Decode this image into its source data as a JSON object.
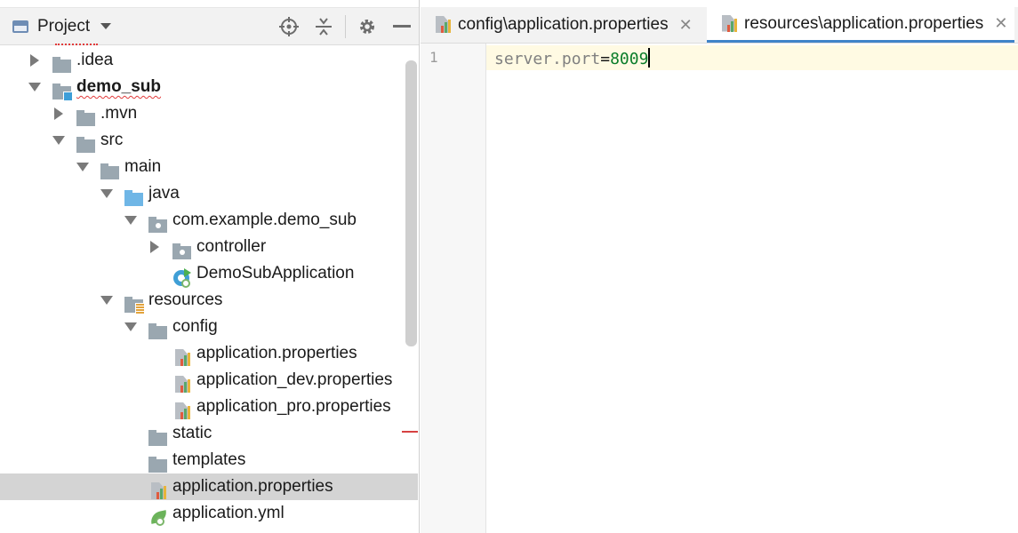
{
  "project_panel": {
    "title": "Project",
    "toolbar": [
      "locate-icon",
      "collapse-all-icon",
      "gear-icon",
      "hide-icon"
    ],
    "tree": [
      {
        "label": ".idea",
        "depth": 1,
        "arrow": "right",
        "icon": "folder"
      },
      {
        "label": "demo_sub",
        "depth": 1,
        "arrow": "down",
        "icon": "module-folder",
        "bold": true,
        "squiggle": true
      },
      {
        "label": ".mvn",
        "depth": 2,
        "arrow": "right",
        "icon": "folder"
      },
      {
        "label": "src",
        "depth": 2,
        "arrow": "down",
        "icon": "folder"
      },
      {
        "label": "main",
        "depth": 3,
        "arrow": "down",
        "icon": "folder"
      },
      {
        "label": "java",
        "depth": 4,
        "arrow": "down",
        "icon": "source-folder"
      },
      {
        "label": "com.example.demo_sub",
        "depth": 5,
        "arrow": "down",
        "icon": "package"
      },
      {
        "label": "controller",
        "depth": 6,
        "arrow": "right",
        "icon": "package"
      },
      {
        "label": "DemoSubApplication",
        "depth": 6,
        "arrow": "none",
        "icon": "spring-app"
      },
      {
        "label": "resources",
        "depth": 4,
        "arrow": "down",
        "icon": "resources-folder"
      },
      {
        "label": "config",
        "depth": 5,
        "arrow": "down",
        "icon": "folder"
      },
      {
        "label": "application.properties",
        "depth": 6,
        "arrow": "none",
        "icon": "properties"
      },
      {
        "label": "application_dev.properties",
        "depth": 6,
        "arrow": "none",
        "icon": "properties"
      },
      {
        "label": "application_pro.properties",
        "depth": 6,
        "arrow": "none",
        "icon": "properties"
      },
      {
        "label": "static",
        "depth": 5,
        "arrow": "none",
        "icon": "folder"
      },
      {
        "label": "templates",
        "depth": 5,
        "arrow": "none",
        "icon": "folder"
      },
      {
        "label": "application.properties",
        "depth": 5,
        "arrow": "none",
        "icon": "properties",
        "selected": true
      },
      {
        "label": "application.yml",
        "depth": 5,
        "arrow": "none",
        "icon": "spring-yml"
      }
    ]
  },
  "editor": {
    "tabs": [
      {
        "label": "config\\application.properties",
        "active": false
      },
      {
        "label": "resources\\application.properties",
        "active": true
      }
    ],
    "line_numbers": [
      "1"
    ],
    "code": {
      "key": "server.port",
      "eq": "=",
      "value": "8009"
    }
  },
  "colors": {
    "accent": "#4083c9",
    "selection": "#d4d4d4",
    "current_line": "#fffae3",
    "value": "#0a7d2a"
  }
}
